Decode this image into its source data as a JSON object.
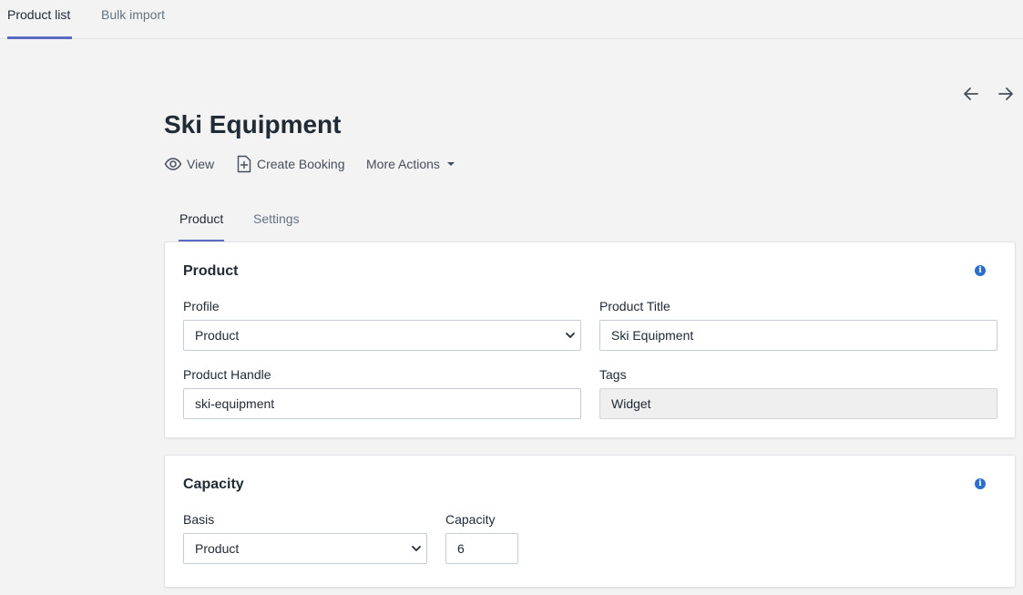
{
  "topnav": {
    "tabs": [
      {
        "label": "Product list",
        "active": true
      },
      {
        "label": "Bulk import",
        "active": false
      }
    ]
  },
  "page": {
    "title": "Ski Equipment",
    "actions": {
      "view": "View",
      "create_booking": "Create Booking",
      "more_actions": "More Actions"
    }
  },
  "subtabs": [
    {
      "label": "Product",
      "active": true
    },
    {
      "label": "Settings",
      "active": false
    }
  ],
  "product_card": {
    "title": "Product",
    "profile": {
      "label": "Profile",
      "value": "Product"
    },
    "product_title": {
      "label": "Product Title",
      "value": "Ski Equipment"
    },
    "product_handle": {
      "label": "Product Handle",
      "value": "ski-equipment"
    },
    "tags": {
      "label": "Tags",
      "value": "Widget"
    }
  },
  "capacity_card": {
    "title": "Capacity",
    "basis": {
      "label": "Basis",
      "value": "Product"
    },
    "capacity": {
      "label": "Capacity",
      "value": "6"
    }
  },
  "colors": {
    "accent": "#5c6ac4",
    "info": "#2c6ecb",
    "background": "#f3f3f3"
  },
  "icons": {
    "prev": "arrow-left-icon",
    "next": "arrow-right-icon",
    "view": "eye-icon",
    "booking": "document-plus-icon",
    "more": "caret-down-icon",
    "info": "info-icon",
    "select": "chevron-down-icon"
  }
}
